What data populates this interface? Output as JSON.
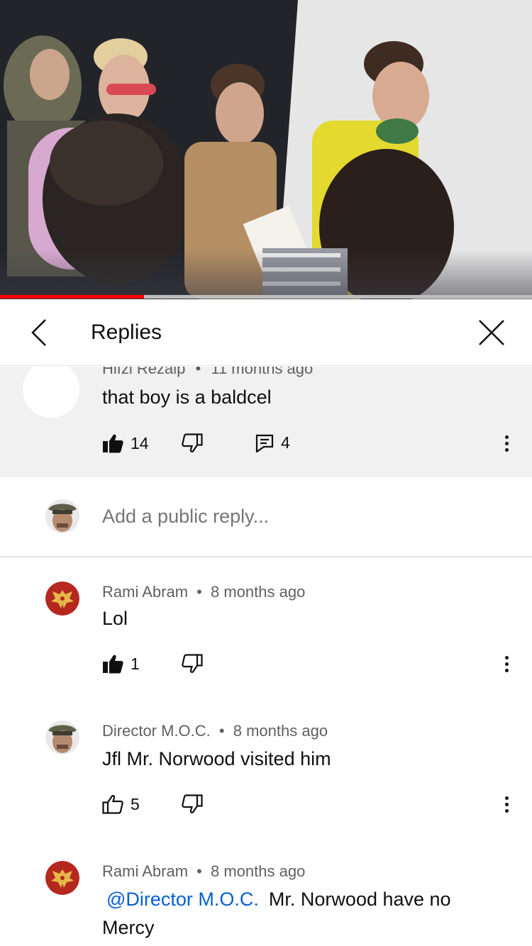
{
  "video": {
    "progress_fraction": 0.27
  },
  "header": {
    "title": "Replies"
  },
  "parent_comment": {
    "author": "Hifzi Rezaip",
    "time": "11 months ago",
    "text": "that boy is a baldcel",
    "likes": "14",
    "replies": "4"
  },
  "add_reply": {
    "placeholder": "Add a public reply..."
  },
  "replies": [
    {
      "author": "Rami Abram",
      "time": "8 months ago",
      "text": "Lol",
      "likes": "1",
      "liked": true
    },
    {
      "author": "Director M.O.C.",
      "time": "8 months ago",
      "text": "Jfl Mr. Norwood visited him",
      "likes": "5",
      "liked": false
    },
    {
      "author": "Rami Abram",
      "time": "8 months ago",
      "mention": "@Director M.O.C.",
      "text": "Mr. Norwood have no Mercy"
    }
  ],
  "separator": "•",
  "colors": {
    "accent_red": "#ff0000",
    "link_blue": "#065fd4",
    "meta_gray": "#606060",
    "block_bg": "#f1f1f1"
  },
  "icons": [
    "back-chevron-icon",
    "close-icon",
    "thumbs-up-icon",
    "thumbs-down-icon",
    "reply-icon",
    "more-vert-icon"
  ]
}
